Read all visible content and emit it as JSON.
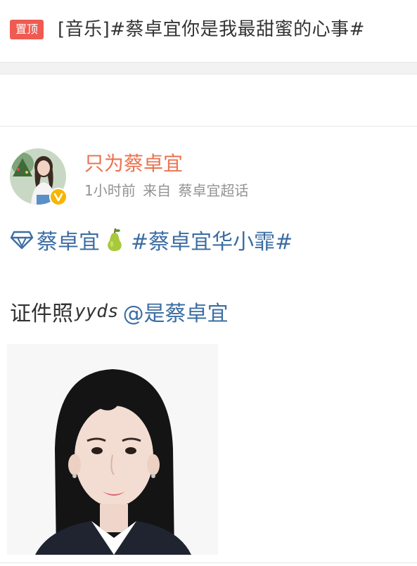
{
  "pinned": {
    "badge": "置顶",
    "title": "[音乐]#蔡卓宜你是我最甜蜜的心事#"
  },
  "post": {
    "author": "只为蔡卓宜",
    "time": "1小时前",
    "source_prefix": "来自",
    "source": "蔡卓宜超话",
    "topics": {
      "super_topic": "蔡卓宜",
      "hashtag": "#蔡卓宜华小霏#"
    },
    "text": {
      "prefix": "证件照",
      "suffix": "yyds",
      "mention": "@是蔡卓宜"
    }
  },
  "icons": {
    "super_topic": "diamond-icon",
    "emoji": "pear-emoji-icon",
    "verified": "verified-badge-icon"
  },
  "colors": {
    "pin_badge": "#ef5b52",
    "author_name": "#eb7350",
    "link": "#3c6da3",
    "verified": "#f7b500"
  }
}
